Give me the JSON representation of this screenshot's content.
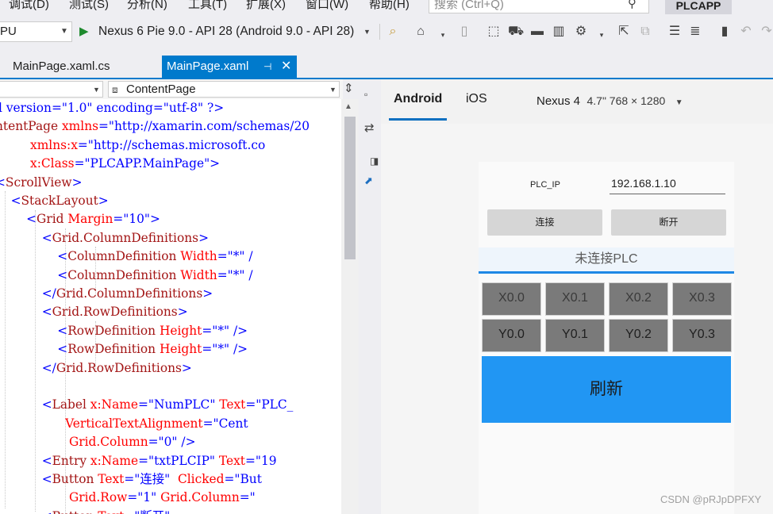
{
  "menu": [
    "调试(D)",
    "测试(S)",
    "分析(N)",
    "工具(T)",
    "扩展(X)",
    "窗口(W)",
    "帮助(H)"
  ],
  "search": {
    "placeholder": "搜索 (Ctrl+Q)"
  },
  "app_name": "PLCAPP",
  "toolbar": {
    "platform": "PU",
    "run_target": "Nexus 6 Pie 9.0 - API 28 (Android 9.0 - API 28)"
  },
  "tabs": [
    {
      "label": "MainPage.xaml.cs"
    },
    {
      "label": "MainPage.xaml"
    }
  ],
  "editor": {
    "nav_right": "ContentPage"
  },
  "code_lines": [
    [
      [
        "p",
        "l version=\"1.0\" encoding=\"utf-8\" ?>"
      ]
    ],
    [
      [
        "t",
        "ntentPage "
      ],
      [
        "a",
        "xmlns"
      ],
      [
        "v",
        "=\"http://xamarin.com/schemas/20"
      ]
    ],
    [
      [
        "s",
        "         "
      ],
      [
        "a",
        "xmlns:x"
      ],
      [
        "v",
        "=\"http://schemas.microsoft.co"
      ]
    ],
    [
      [
        "s",
        "         "
      ],
      [
        "a",
        "x:Class"
      ],
      [
        "v",
        "=\"PLCAPP.MainPage\">"
      ]
    ],
    [
      [
        "v",
        "<"
      ],
      [
        "t",
        "ScrollView"
      ],
      [
        "v",
        ">"
      ]
    ],
    [
      [
        "s",
        "    "
      ],
      [
        "v",
        "<"
      ],
      [
        "t",
        "StackLayout"
      ],
      [
        "v",
        ">"
      ]
    ],
    [
      [
        "s",
        "        "
      ],
      [
        "v",
        "<"
      ],
      [
        "t",
        "Grid "
      ],
      [
        "a",
        "Margin"
      ],
      [
        "v",
        "=\"10\">"
      ]
    ],
    [
      [
        "s",
        "            "
      ],
      [
        "v",
        "<"
      ],
      [
        "t",
        "Grid.ColumnDefinitions"
      ],
      [
        "v",
        ">"
      ]
    ],
    [
      [
        "s",
        "                "
      ],
      [
        "v",
        "<"
      ],
      [
        "t",
        "ColumnDefinition "
      ],
      [
        "a",
        "Width"
      ],
      [
        "v",
        "=\"*\" /"
      ]
    ],
    [
      [
        "s",
        "                "
      ],
      [
        "v",
        "<"
      ],
      [
        "t",
        "ColumnDefinition "
      ],
      [
        "a",
        "Width"
      ],
      [
        "v",
        "=\"*\" /"
      ]
    ],
    [
      [
        "s",
        "            "
      ],
      [
        "v",
        "</"
      ],
      [
        "t",
        "Grid.ColumnDefinitions"
      ],
      [
        "v",
        ">"
      ]
    ],
    [
      [
        "s",
        "            "
      ],
      [
        "v",
        "<"
      ],
      [
        "t",
        "Grid.RowDefinitions"
      ],
      [
        "v",
        ">"
      ]
    ],
    [
      [
        "s",
        "                "
      ],
      [
        "v",
        "<"
      ],
      [
        "t",
        "RowDefinition "
      ],
      [
        "a",
        "Height"
      ],
      [
        "v",
        "=\"*\" />"
      ]
    ],
    [
      [
        "s",
        "                "
      ],
      [
        "v",
        "<"
      ],
      [
        "t",
        "RowDefinition "
      ],
      [
        "a",
        "Height"
      ],
      [
        "v",
        "=\"*\" />"
      ]
    ],
    [
      [
        "s",
        "            "
      ],
      [
        "v",
        "</"
      ],
      [
        "t",
        "Grid.RowDefinitions"
      ],
      [
        "v",
        ">"
      ]
    ],
    [
      [
        "s",
        ""
      ]
    ],
    [
      [
        "s",
        "            "
      ],
      [
        "v",
        "<"
      ],
      [
        "t",
        "Label "
      ],
      [
        "a",
        "x:Name"
      ],
      [
        "v",
        "=\"NumPLC\" "
      ],
      [
        "a",
        "Text"
      ],
      [
        "v",
        "=\"PLC_"
      ]
    ],
    [
      [
        "s",
        "                  "
      ],
      [
        "a",
        "VerticalTextAlignment"
      ],
      [
        "v",
        "=\"Cent"
      ]
    ],
    [
      [
        "s",
        "                   "
      ],
      [
        "a",
        "Grid.Column"
      ],
      [
        "v",
        "=\"0\" />"
      ]
    ],
    [
      [
        "s",
        "            "
      ],
      [
        "v",
        "<"
      ],
      [
        "t",
        "Entry "
      ],
      [
        "a",
        "x:Name"
      ],
      [
        "v",
        "=\"txtPLCIP\" "
      ],
      [
        "a",
        "Text"
      ],
      [
        "v",
        "=\"19"
      ]
    ],
    [
      [
        "s",
        "            "
      ],
      [
        "v",
        "<"
      ],
      [
        "t",
        "Button "
      ],
      [
        "a",
        "Text"
      ],
      [
        "v",
        "=\"连接\"  "
      ],
      [
        "a",
        "Clicked"
      ],
      [
        "v",
        "=\"But"
      ]
    ],
    [
      [
        "s",
        "                   "
      ],
      [
        "a",
        "Grid.Row"
      ],
      [
        "v",
        "=\"1\" "
      ],
      [
        "a",
        "Grid.Column"
      ],
      [
        "v",
        "=\""
      ]
    ],
    [
      [
        "s",
        "            "
      ],
      [
        "v",
        "<"
      ],
      [
        "t",
        "Button "
      ],
      [
        "a",
        "Text"
      ],
      [
        "v",
        "=\"断开\""
      ]
    ]
  ],
  "preview": {
    "tab_android": "Android",
    "tab_ios": "iOS",
    "device_name": "Nexus 4",
    "device_spec": "4.7\" 768 × 1280",
    "ip_label": "PLC_IP",
    "ip_value": "192.168.1.10",
    "connect": "连接",
    "disconnect": "断开",
    "status": "未连接PLC",
    "inputs": [
      "X0.0",
      "X0.1",
      "X0.2",
      "X0.3"
    ],
    "outputs": [
      "Y0.0",
      "Y0.1",
      "Y0.2",
      "Y0.3"
    ],
    "refresh": "刷新"
  },
  "watermark": "CSDN @pRJpDPFXY",
  "colors": {
    "accent": "#007acc",
    "refresh": "#2196f3",
    "cell": "#7a7a7a"
  }
}
